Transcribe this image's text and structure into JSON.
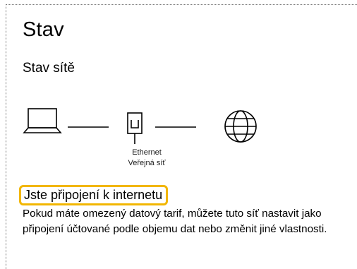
{
  "page": {
    "title": "Stav",
    "subtitle": "Stav sítě"
  },
  "network": {
    "adapter_name": "Ethernet",
    "network_type": "Veřejná síť",
    "icons": [
      "laptop-icon",
      "ethernet-icon",
      "globe-icon"
    ]
  },
  "status": {
    "heading": "Jste připojení k internetu",
    "description": "Pokud máte omezený datový tarif, můžete tuto síť nastavit jako připojení účtované podle objemu dat nebo změnit jiné vlastnosti.",
    "highlight_color": "#f2b600"
  }
}
